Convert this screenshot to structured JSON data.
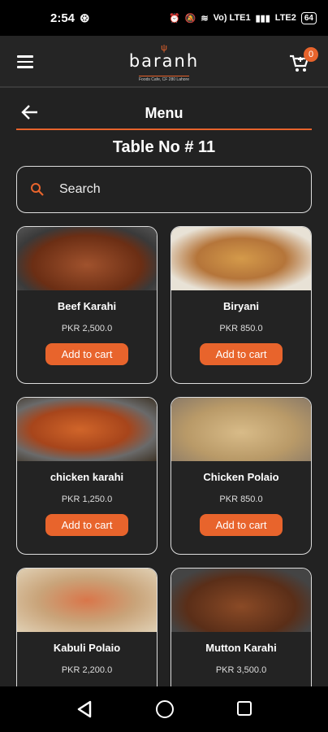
{
  "status": {
    "time": "2:54",
    "battery": "64",
    "net": "Vo) LTE1",
    "net2": "LTE2"
  },
  "header": {
    "logo_text": "baranh",
    "logo_tagline": "Foods Cafe, CF 280 Lahore",
    "cart_count": "0"
  },
  "menu_header": {
    "title": "Menu"
  },
  "table_label": "Table No # 11",
  "search": {
    "placeholder": "Search"
  },
  "add_label": "Add to cart",
  "items": [
    {
      "name": "Beef Karahi",
      "price": "PKR 2,500.0",
      "img_color": "#7a3a1e"
    },
    {
      "name": "Biryani",
      "price": "PKR 850.0",
      "img_color": "#c48a3a"
    },
    {
      "name": "chicken karahi",
      "price": "PKR 1,250.0",
      "img_color": "#b6521f"
    },
    {
      "name": "Chicken Polaio",
      "price": "PKR 850.0",
      "img_color": "#c9ac7a"
    },
    {
      "name": "Kabuli Polaio",
      "price": "PKR 2,200.0",
      "img_color": "#c8946a"
    },
    {
      "name": "Mutton Karahi",
      "price": "PKR 3,500.0",
      "img_color": "#6a3a22"
    }
  ]
}
